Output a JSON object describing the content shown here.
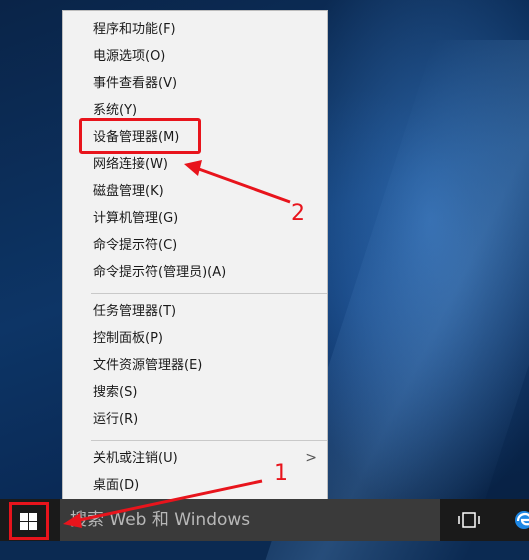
{
  "menu": {
    "items": [
      {
        "label": "程序和功能(F)"
      },
      {
        "label": "电源选项(O)"
      },
      {
        "label": "事件查看器(V)"
      },
      {
        "label": "系统(Y)"
      },
      {
        "label": "设备管理器(M)"
      },
      {
        "label": "网络连接(W)"
      },
      {
        "label": "磁盘管理(K)"
      },
      {
        "label": "计算机管理(G)"
      },
      {
        "label": "命令提示符(C)"
      },
      {
        "label": "命令提示符(管理员)(A)"
      },
      {
        "label": "任务管理器(T)"
      },
      {
        "label": "控制面板(P)"
      },
      {
        "label": "文件资源管理器(E)"
      },
      {
        "label": "搜索(S)"
      },
      {
        "label": "运行(R)"
      },
      {
        "label": "关机或注销(U)"
      },
      {
        "label": "桌面(D)"
      }
    ],
    "submenu_chevron": ">"
  },
  "taskbar": {
    "search_text": "搜索 Web 和 Windows"
  },
  "annotations": {
    "label_1": "1",
    "label_2": "2",
    "color": "#e8141c"
  }
}
